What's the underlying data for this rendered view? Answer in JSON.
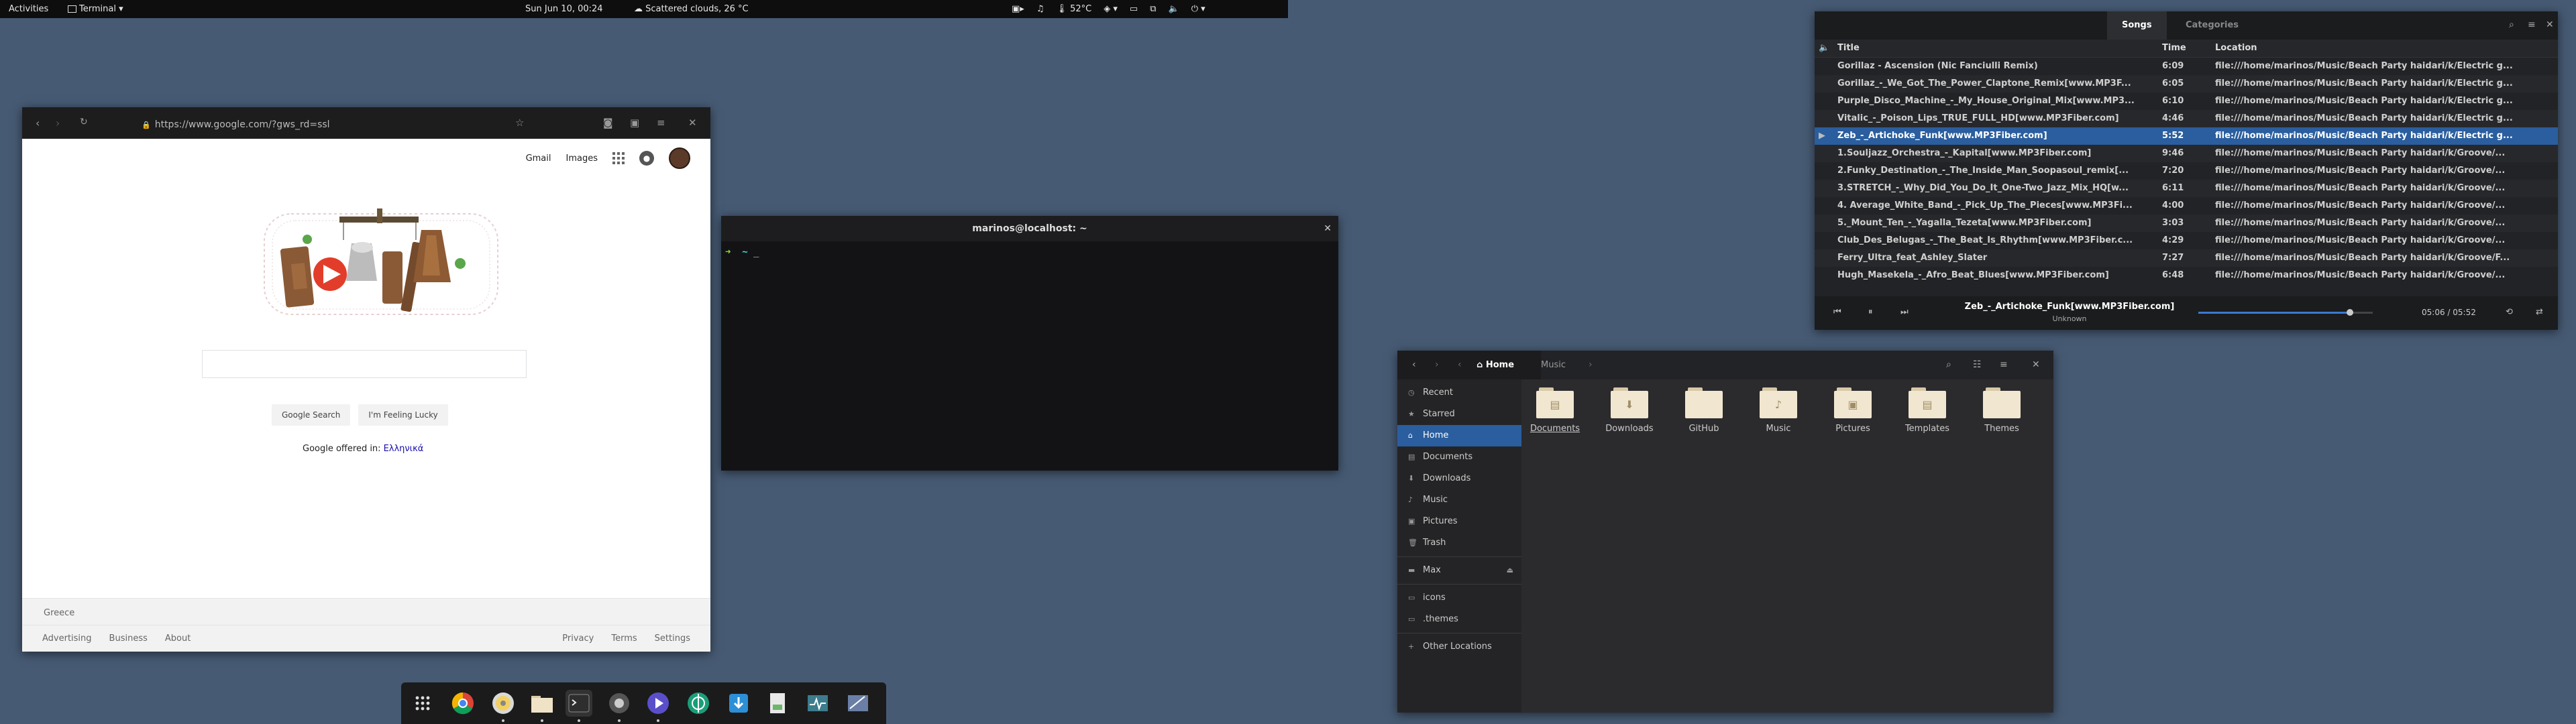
{
  "topbar": {
    "activities": "Activities",
    "app_menu": "Terminal",
    "clock": "Sun Jun 10, 00:24",
    "weather": "Scattered clouds, 26 °C",
    "temperature": "52°C"
  },
  "browser": {
    "url": "https://www.google.com/?gws_rd=ssl",
    "links": {
      "gmail": "Gmail",
      "images": "Images"
    },
    "buttons": {
      "search": "Google Search",
      "lucky": "I'm Feeling Lucky"
    },
    "offered_in": "Google offered in:",
    "language": "Ελληνικά",
    "footer": {
      "country": "Greece",
      "left": [
        "Advertising",
        "Business",
        "About"
      ],
      "right": [
        "Privacy",
        "Terms",
        "Settings"
      ]
    }
  },
  "terminal": {
    "title": "marinos@localhost: ~",
    "prompt_arrow": "➜",
    "prompt_dir": "~",
    "cursor": "_"
  },
  "music": {
    "tabs": [
      "Songs",
      "Categories"
    ],
    "columns": {
      "title": "Title",
      "time": "Time",
      "location": "Location"
    },
    "songs": [
      {
        "title": "Gorillaz - Ascension (Nic Fanciulli Remix)",
        "time": "6:09",
        "location": "file:///home/marinos/Music/Beach Party haidari/k/Electric g..."
      },
      {
        "title": "Gorillaz_-_We_Got_The_Power_Claptone_Remix[www.MP3F...",
        "time": "6:05",
        "location": "file:///home/marinos/Music/Beach Party haidari/k/Electric g..."
      },
      {
        "title": "Purple_Disco_Machine_-_My_House_Original_Mix[www.MP3...",
        "time": "6:10",
        "location": "file:///home/marinos/Music/Beach Party haidari/k/Electric g..."
      },
      {
        "title": "Vitalic_-_Poison_Lips_TRUE_FULL_HD[www.MP3Fiber.com]",
        "time": "4:46",
        "location": "file:///home/marinos/Music/Beach Party haidari/k/Electric g..."
      },
      {
        "title": "Zeb_-_Artichoke_Funk[www.MP3Fiber.com]",
        "time": "5:52",
        "location": "file:///home/marinos/Music/Beach Party haidari/k/Electric g...",
        "playing": true
      },
      {
        "title": "1.Souljazz_Orchestra_-_Kapital[www.MP3Fiber.com]",
        "time": "9:46",
        "location": "file:///home/marinos/Music/Beach Party haidari/k/Groove/..."
      },
      {
        "title": "2.Funky_Destination_-_The_Inside_Man_Soopasoul_remix[...",
        "time": "7:20",
        "location": "file:///home/marinos/Music/Beach Party haidari/k/Groove/..."
      },
      {
        "title": "3.STRETCH_-_Why_Did_You_Do_It_One-Two_Jazz_Mix_HQ[w...",
        "time": "6:11",
        "location": "file:///home/marinos/Music/Beach Party haidari/k/Groove/..."
      },
      {
        "title": "4. Average_White_Band_-_Pick_Up_The_Pieces[www.MP3Fi...",
        "time": "4:00",
        "location": "file:///home/marinos/Music/Beach Party haidari/k/Groove/..."
      },
      {
        "title": "5._Mount_Ten_-_Yagalla_Tezeta[www.MP3Fiber.com]",
        "time": "3:03",
        "location": "file:///home/marinos/Music/Beach Party haidari/k/Groove/..."
      },
      {
        "title": "Club_Des_Belugas_-_The_Beat_Is_Rhythm[www.MP3Fiber.c...",
        "time": "4:29",
        "location": "file:///home/marinos/Music/Beach Party haidari/k/Groove/..."
      },
      {
        "title": "Ferry_Ultra_feat_Ashley_Slater",
        "time": "7:27",
        "location": "file:///home/marinos/Music/Beach Party haidari/k/Groove/F..."
      },
      {
        "title": "Hugh_Masekela_-_Afro_Beat_Blues[www.MP3Fiber.com]",
        "time": "6:48",
        "location": "file:///home/marinos/Music/Beach Party haidari/k/Groove/..."
      }
    ],
    "now_playing": "Zeb_-_Artichoke_Funk[www.MP3Fiber.com]",
    "artist": "Unknown",
    "elapsed": "05:06 / 05:52",
    "progress": 0.87
  },
  "files": {
    "crumbs": {
      "home": "Home",
      "music": "Music"
    },
    "sidebar": {
      "places": [
        "Recent",
        "Starred",
        "Home",
        "Documents",
        "Downloads",
        "Music",
        "Pictures",
        "Trash"
      ],
      "devices": [
        "Max"
      ],
      "bookmarks": [
        "icons",
        ".themes"
      ],
      "other": "Other Locations"
    },
    "folders": [
      "Documents",
      "Downloads",
      "GitHub",
      "Music",
      "Pictures",
      "Templates",
      "Themes"
    ]
  },
  "dock": {
    "apps": [
      "show-apps",
      "chrome",
      "disks",
      "files",
      "terminal",
      "screenshot",
      "music",
      "network",
      "downloader",
      "text-editor",
      "system-monitor",
      "screen-capture"
    ]
  },
  "colors": {
    "desktop": "#465a73",
    "accent": "#2a5e9e"
  }
}
